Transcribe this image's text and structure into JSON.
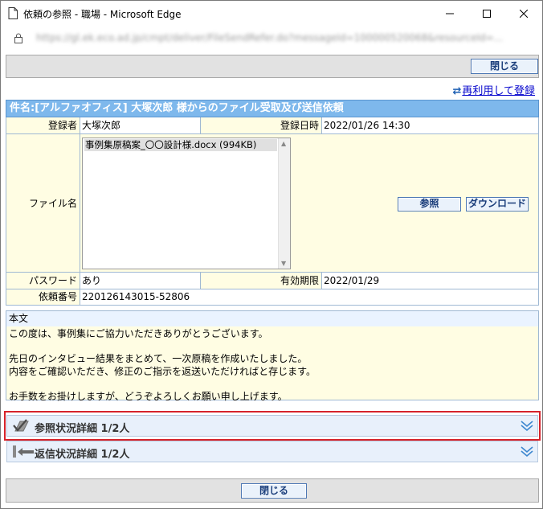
{
  "window": {
    "title": "依頼の参照 - 職場 - Microsoft Edge",
    "url": "https://gl.ek.eco.ad.jp/cmpt/deliver/FileSendRefer.do?messageId=100000520068&resourceId=..."
  },
  "toolbar": {
    "close_label": "閉じる"
  },
  "reuse_link": {
    "label": "再利用して登録"
  },
  "subject": {
    "text": "件名:[アルファオフィス] 大塚次郎 様からのファイル受取及び送信依頼"
  },
  "details": {
    "registrant_label": "登録者",
    "registrant_value": "大塚次郎",
    "registered_at_label": "登録日時",
    "registered_at_value": "2022/01/26 14:30",
    "filename_label": "ファイル名",
    "files": [
      "事例集原稿案_〇〇設計様.docx (994KB)"
    ],
    "browse_label": "参照",
    "download_label": "ダウンロード",
    "password_label": "パスワード",
    "password_value": "あり",
    "expiry_label": "有効期限",
    "expiry_value": "2022/01/29",
    "request_no_label": "依頼番号",
    "request_no_value": "220126143015-52806"
  },
  "body": {
    "header": "本文",
    "lines": [
      "この度は、事例集にご協力いただきありがとうございます。",
      "",
      "先日のインタビュー結果をまとめて、一次原稿を作成いたしました。",
      "内容をご確認いただき、修正のご指示を返送いただければと存じます。",
      "",
      "お手数をお掛けしますが、どうぞよろしくお願い申し上げます。"
    ]
  },
  "accordions": {
    "reference_status": "参照状況詳細 1/2人",
    "reply_status": "返信状況詳細 1/2人"
  },
  "colors": {
    "accent": "#7eb8ec",
    "highlight": "#d6232b",
    "link": "#0000cc"
  }
}
